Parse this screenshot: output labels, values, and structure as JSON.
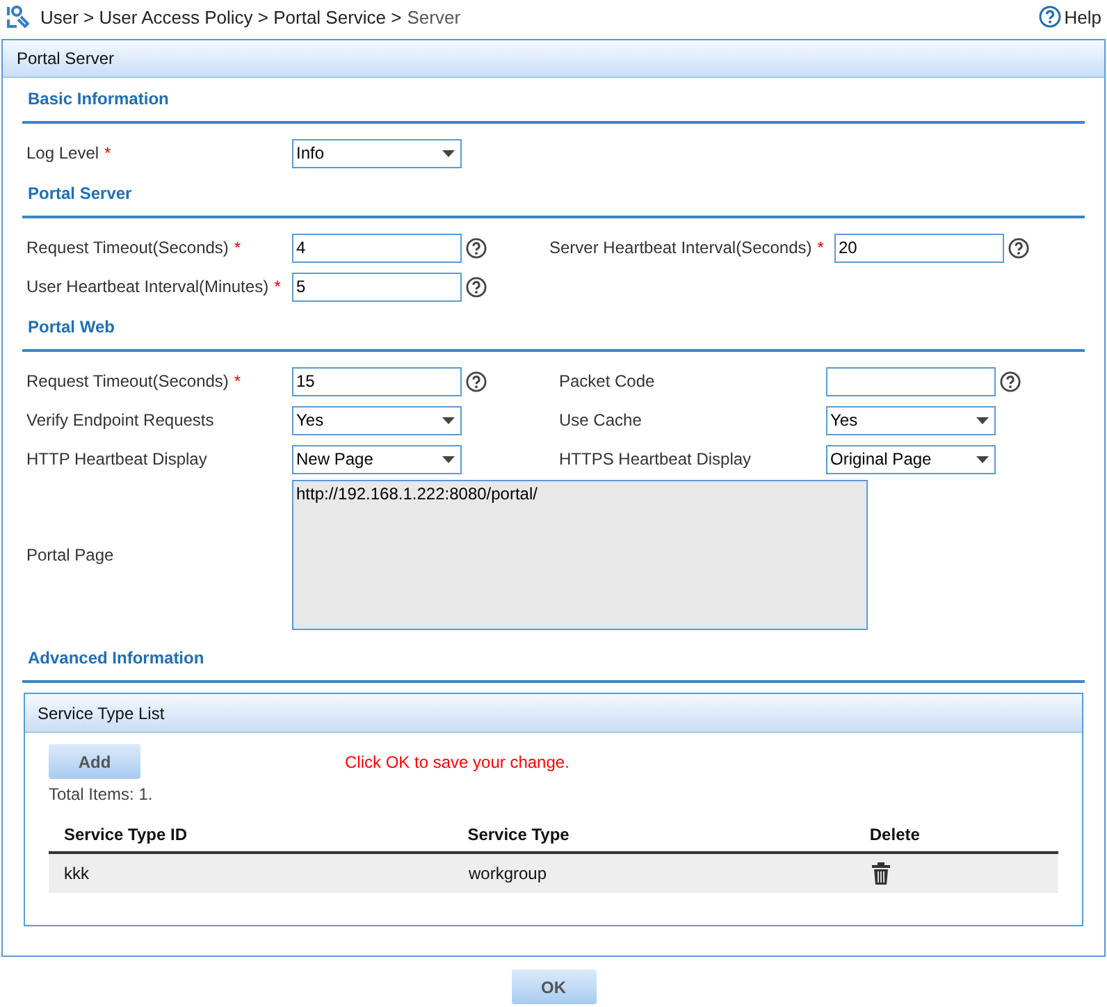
{
  "breadcrumb": {
    "parts": [
      "User",
      "User Access Policy",
      "Portal Service"
    ],
    "current": "Server",
    "separator": ">"
  },
  "help_link": "Help",
  "panel": {
    "title": "Portal Server"
  },
  "sections": [
    {
      "title": "Basic Information",
      "rows": [
        [
          {
            "label": "Log Level",
            "mark": "*",
            "kind": "select",
            "value": "Info",
            "help": false
          }
        ]
      ]
    },
    {
      "title": "Portal Server",
      "rows": [
        [
          {
            "label": "Request Timeout(Seconds)",
            "mark": "*",
            "kind": "text",
            "value": "4",
            "help": true
          },
          {
            "label": "Server Heartbeat Interval(Seconds)",
            "mark": "*",
            "kind": "text",
            "value": "20",
            "help": true
          }
        ],
        [
          {
            "label": "User Heartbeat Interval(Minutes)",
            "mark": "*",
            "kind": "text",
            "value": "5",
            "help": true
          }
        ]
      ]
    },
    {
      "title": "Portal Web",
      "rows": [
        [
          {
            "label": "Request Timeout(Seconds)",
            "mark": "*",
            "kind": "text",
            "value": "15",
            "help": true
          },
          {
            "label": "Packet Code",
            "kind": "text",
            "help": true
          }
        ],
        [
          {
            "label": "Verify Endpoint Requests",
            "kind": "select",
            "value": "Yes",
            "help": false
          },
          {
            "label": "Use Cache",
            "kind": "select",
            "value": "Yes",
            "help": false
          }
        ],
        [
          {
            "label": "HTTP Heartbeat Display",
            "kind": "select",
            "value": "New Page",
            "help": false
          },
          {
            "label": "HTTPS Heartbeat Display",
            "kind": "select",
            "value": "Original Page",
            "help": false
          }
        ],
        [
          {
            "label": "Portal Page",
            "kind": "textarea",
            "value": "http://192.168.1.222:8080/portal/",
            "help": false
          }
        ]
      ]
    },
    {
      "title": "Advanced Information"
    }
  ],
  "service_list": {
    "title": "Service Type List",
    "add_button": "Add",
    "message": "Click OK to save your change.",
    "total": "Total Items: 1.",
    "columns": [
      "Service Type ID",
      "Service Type",
      "Delete"
    ],
    "rows": [
      {
        "id": "kkk",
        "type": "workgroup"
      }
    ]
  },
  "ok_button": "OK"
}
